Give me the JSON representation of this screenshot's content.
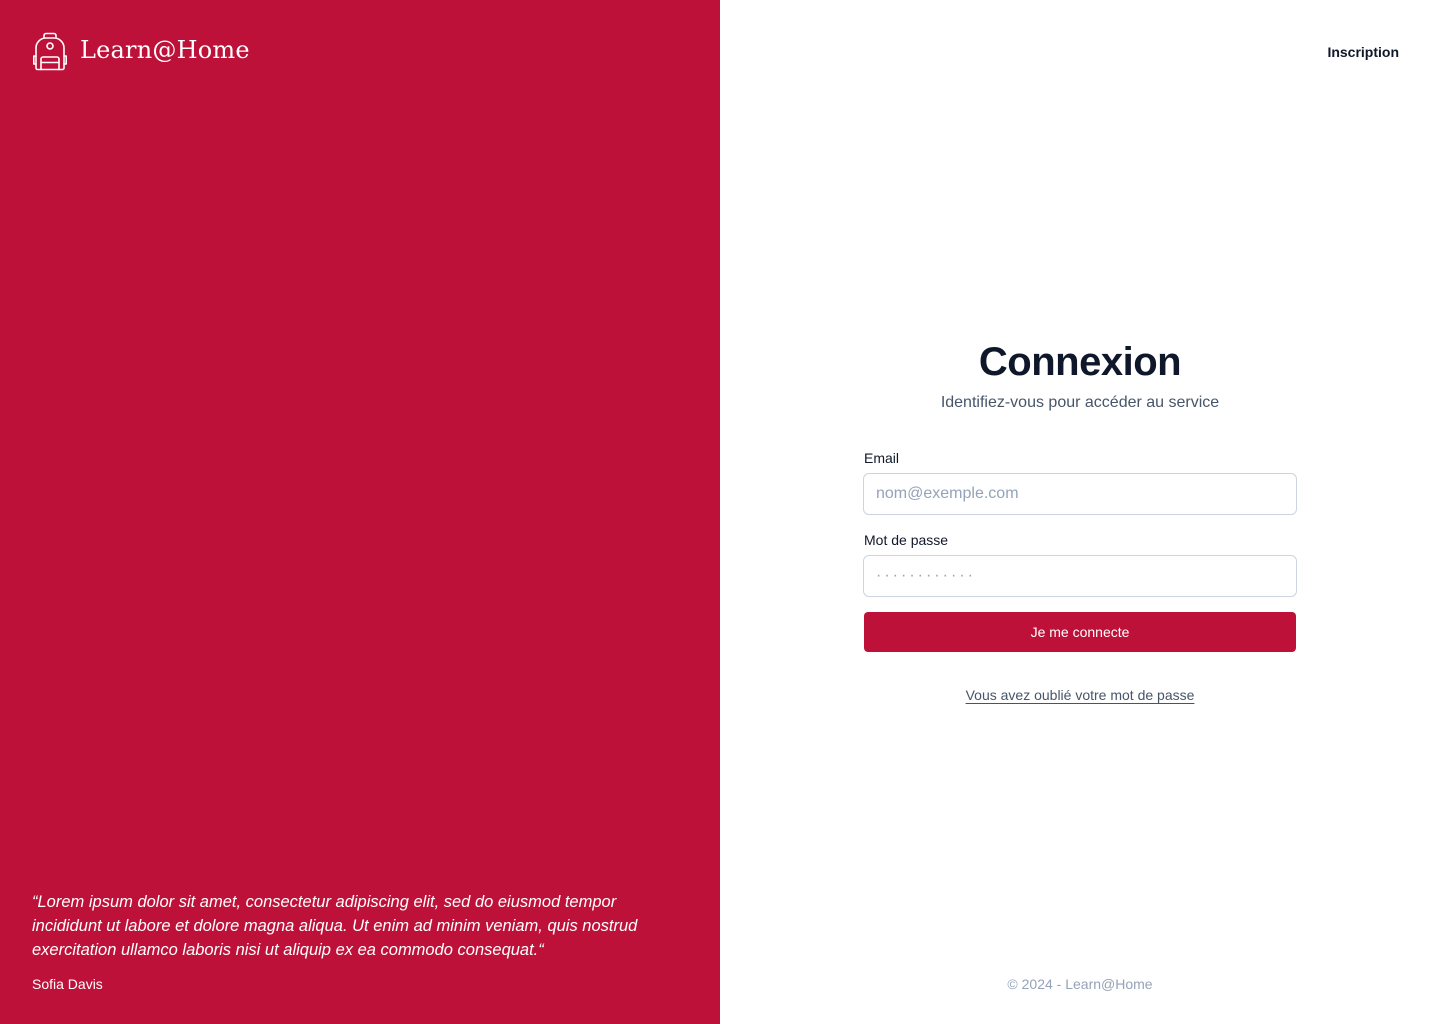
{
  "colors": {
    "brand": "#bd1139",
    "heading": "#0f172a",
    "muted": "#475569",
    "placeholder": "#94a3b8",
    "border": "#cbd5e1"
  },
  "brand": {
    "icon": "backpack-icon",
    "name": "Learn@Home"
  },
  "nav": {
    "signup_label": "Inscription"
  },
  "testimonial": {
    "quote": "“Lorem ipsum dolor sit amet, consectetur adipiscing elit, sed do eiusmod tempor incididunt ut labore et dolore magna aliqua. Ut enim ad minim veniam, quis nostrud exercitation ullamco laboris nisi ut aliquip ex ea commodo consequat.“",
    "author": "Sofia Davis"
  },
  "login": {
    "title": "Connexion",
    "subtitle": "Identifiez-vous pour accéder au service",
    "email_label": "Email",
    "email_placeholder": "nom@exemple.com",
    "email_value": "",
    "password_label": "Mot de passe",
    "password_placeholder": "············",
    "password_value": "",
    "submit_label": "Je me connecte",
    "forgot_label": "Vous avez oublié votre mot de passe"
  },
  "footer": {
    "copyright": "© 2024 - Learn@Home"
  }
}
